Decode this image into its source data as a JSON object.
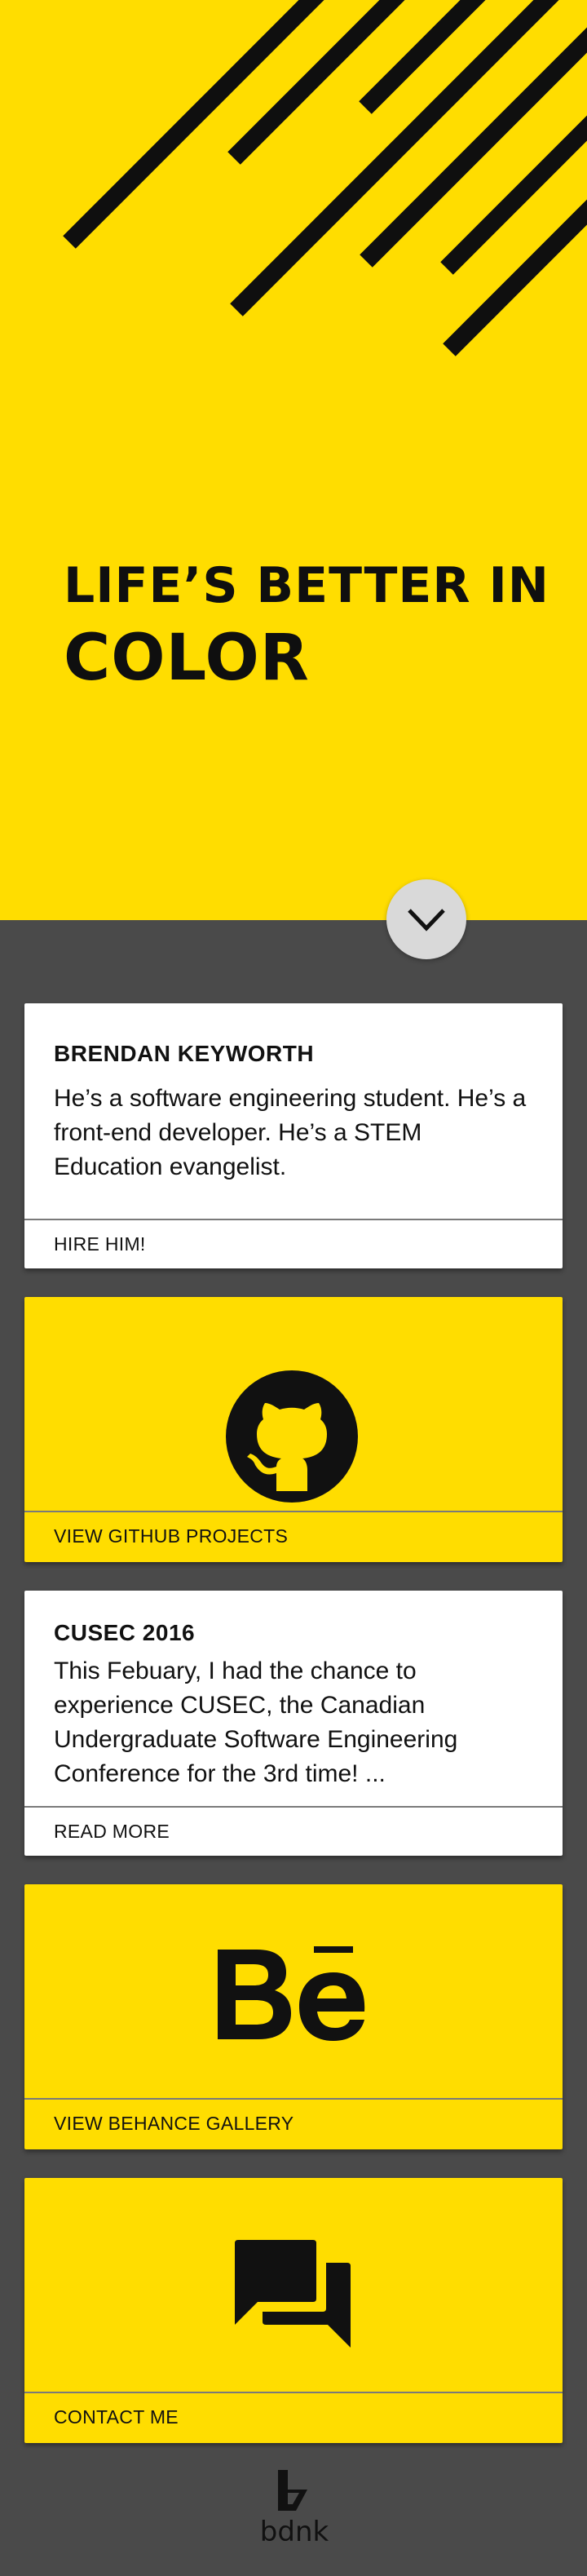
{
  "hero": {
    "title_line1": "LIFE’S BETTER IN",
    "title_line2": "COLOR"
  },
  "scroll_button": {
    "icon": "chevron-down-icon"
  },
  "cards": {
    "about": {
      "title": "BRENDAN KEYWORTH",
      "body": "He’s a software engineering student. He’s a front-end developer. He’s a STEM Education evangelist.",
      "action": "HIRE HIM!"
    },
    "github": {
      "icon": "github-icon",
      "action": "VIEW GITHUB PROJECTS"
    },
    "cusec": {
      "title": "CUSEC 2016",
      "body": "This Febuary, I had the chance to experience CUSEC, the Canadian Undergraduate Software Engineering Conference for the 3rd time! ...",
      "action": "READ MORE"
    },
    "behance": {
      "icon": "behance-icon",
      "action": "VIEW BEHANCE GALLERY"
    },
    "contact": {
      "icon": "chat-bubbles-icon",
      "action": "CONTACT ME"
    }
  },
  "footer": {
    "logo_text": "bdnk"
  },
  "colors": {
    "accent": "#ffdd00",
    "background": "#4a4a4a",
    "card": "#ffffff",
    "text": "#111111"
  }
}
